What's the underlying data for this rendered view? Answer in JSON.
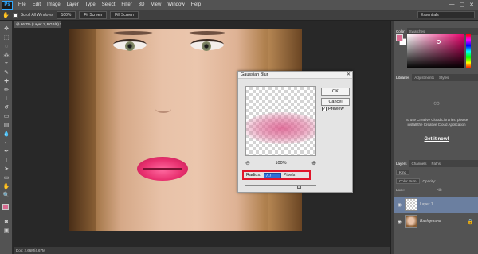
{
  "app": {
    "logo": "Ps"
  },
  "menubar": {
    "items": [
      "File",
      "Edit",
      "Image",
      "Layer",
      "Type",
      "Select",
      "Filter",
      "3D",
      "View",
      "Window",
      "Help"
    ],
    "window_controls": [
      "—",
      "▢",
      "✕"
    ]
  },
  "options_bar": {
    "scroll_all": "Scroll All Windows",
    "zoom_100": "100%",
    "fit_screen": "Fit Screen",
    "fill_screen": "Fill Screen",
    "workspace": "Essentials"
  },
  "document": {
    "tab_title": "@ 66.7% (Layer 1, RGB/8) *",
    "status": "Doc: 2.66M/4.67M"
  },
  "gaussian_blur": {
    "title": "Gaussian Blur",
    "ok_label": "OK",
    "cancel_label": "Cancel",
    "preview_label": "Preview",
    "preview_checked": true,
    "zoom_level": "100%",
    "radius_label": "Radius:",
    "radius_value": "7.7",
    "radius_unit": "Pixels"
  },
  "panels": {
    "color_tabs": [
      "Color",
      "Swatches"
    ],
    "foreground_color": "#d86a90",
    "libraries_tabs": [
      "Libraries",
      "Adjustments",
      "Styles"
    ],
    "cc_message": "To use Creative Cloud Libraries, please install the Creative Cloud Application",
    "cc_link": "Get it now!",
    "layers_tabs": [
      "Layers",
      "Channels",
      "Paths"
    ],
    "kind_label": "Kind",
    "blend_mode": "Color Burn",
    "opacity_label": "Opacity:",
    "lock_label": "Lock:",
    "fill_label": "Fill:",
    "layers": [
      {
        "name": "Layer 1",
        "selected": true
      },
      {
        "name": "Background",
        "selected": false
      }
    ]
  }
}
